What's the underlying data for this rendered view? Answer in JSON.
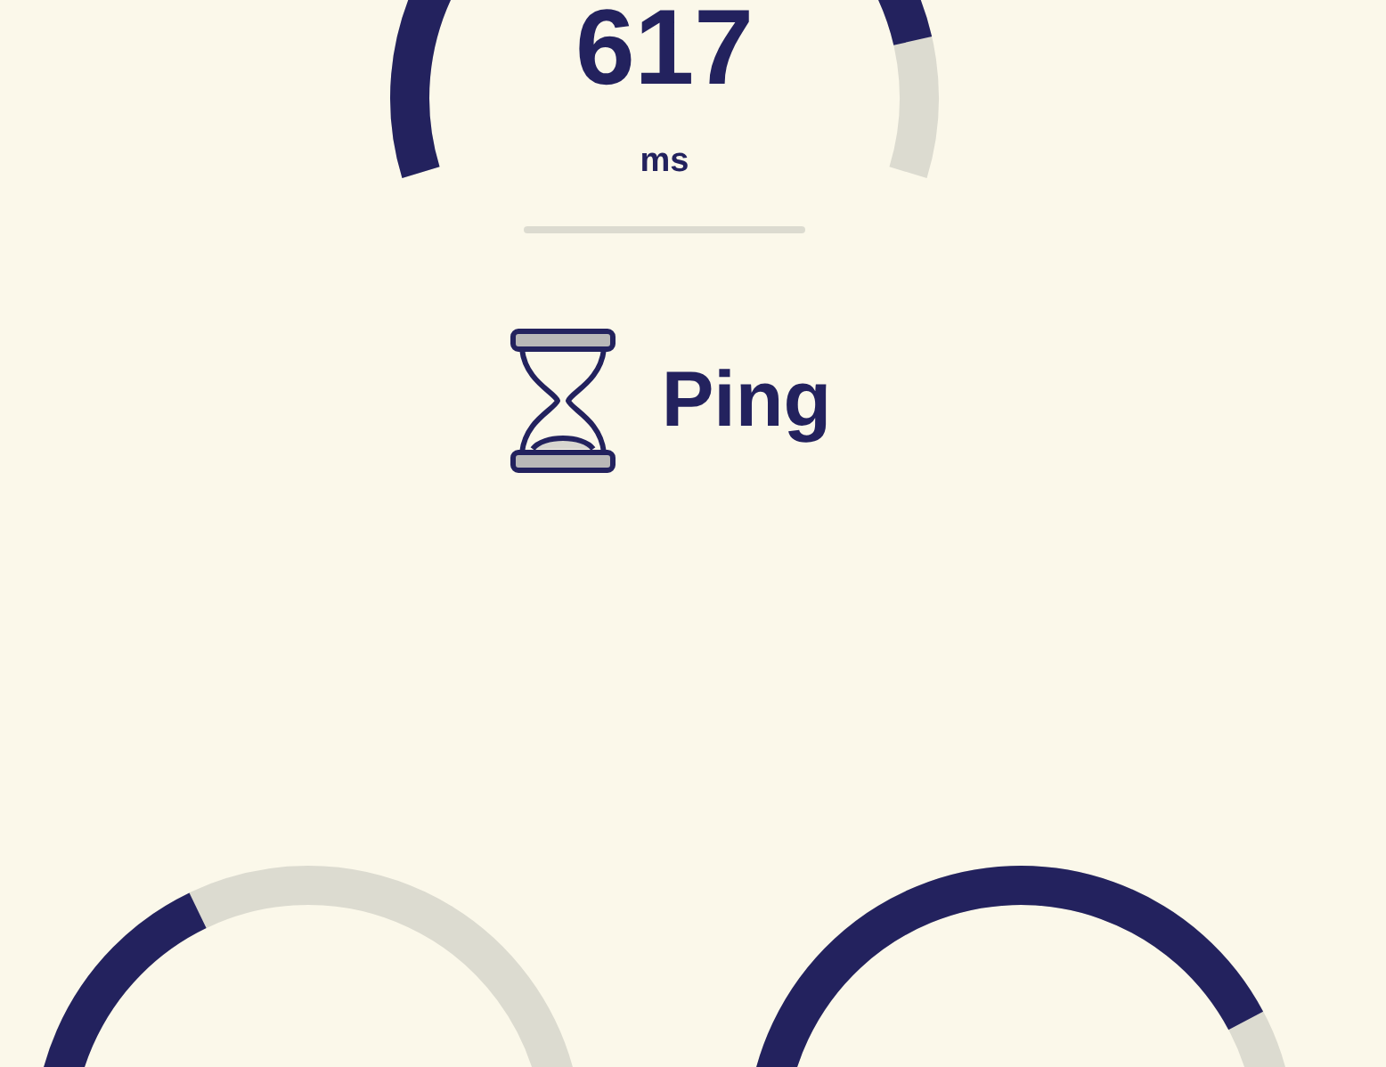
{
  "ping_gauge": {
    "value": "617",
    "unit": "ms"
  },
  "ping_label": "Ping"
}
